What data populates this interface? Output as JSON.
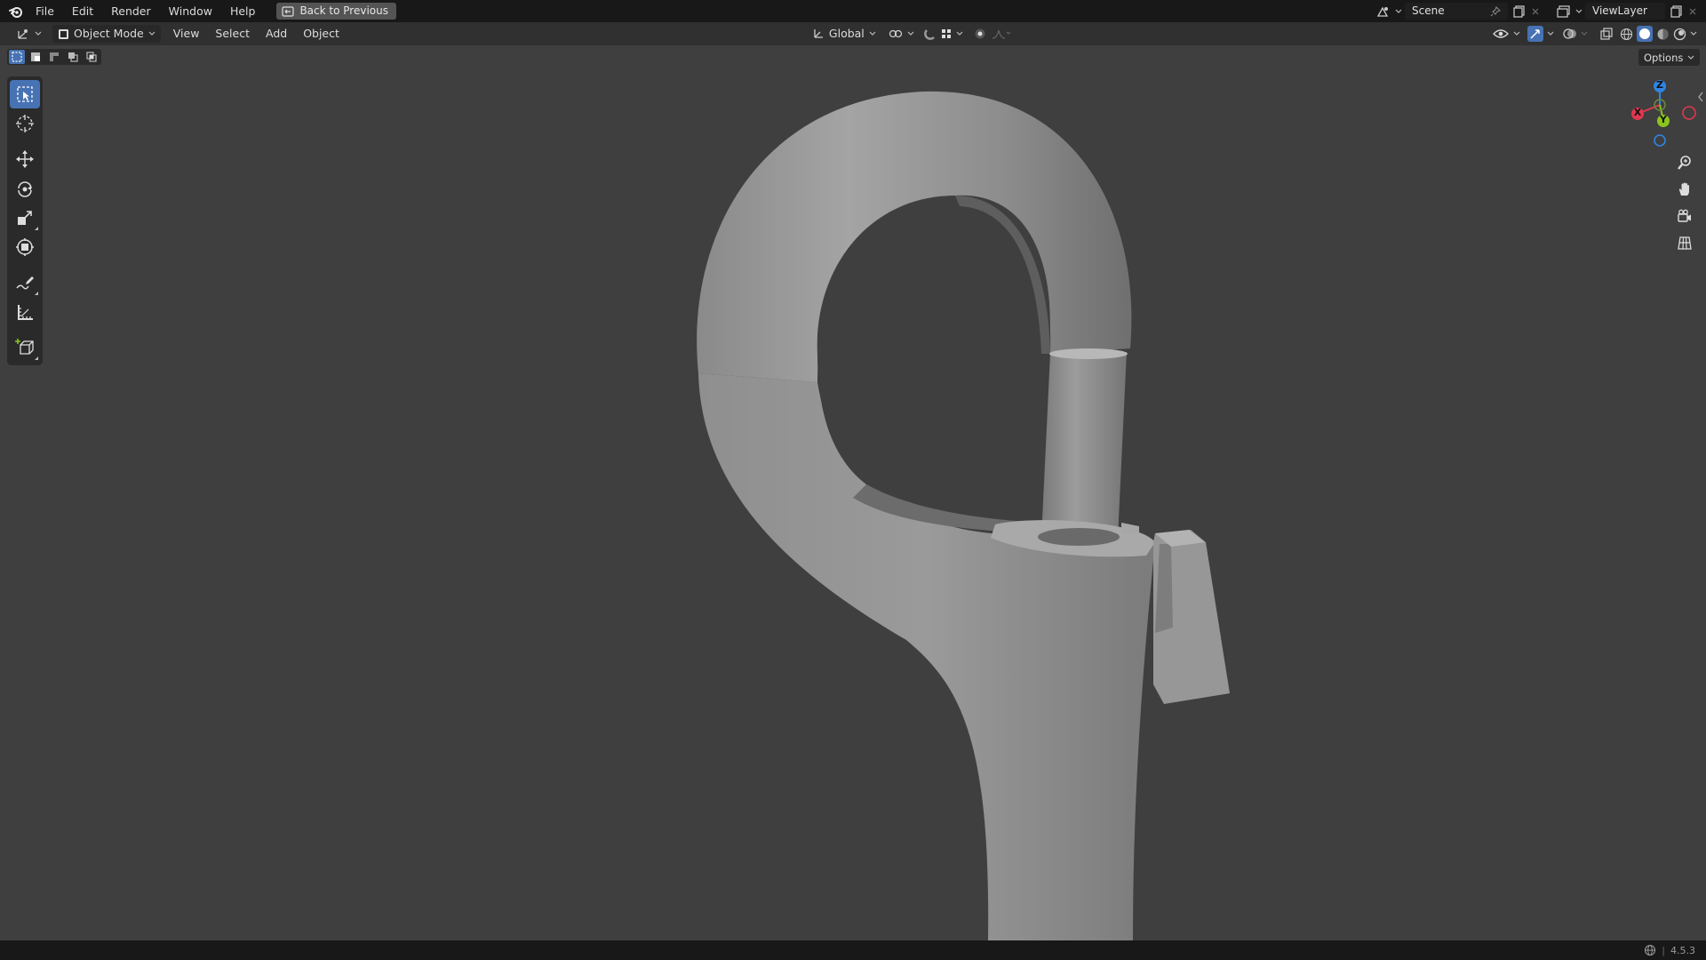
{
  "app": {
    "name": "Blender",
    "version": "4.5.3"
  },
  "menu": {
    "items": [
      "File",
      "Edit",
      "Render",
      "Window",
      "Help"
    ],
    "back_button": "Back to Previous"
  },
  "workspace": {
    "scene": "Scene",
    "view_layer": "ViewLayer"
  },
  "header": {
    "mode": "Object Mode",
    "view": "View",
    "select": "Select",
    "add": "Add",
    "object": "Object",
    "transform_orientation": "Global",
    "options": "Options"
  },
  "gizmo": {
    "x": "X",
    "y": "Y",
    "z": "Z"
  },
  "colors": {
    "accent": "#4772b3",
    "axis_x": "#e0384f",
    "axis_y": "#8bc41e",
    "axis_z": "#2f84e3",
    "viewport_bg": "#3f3f3f"
  },
  "tools": [
    "select-box-tool",
    "cursor-tool",
    "move-tool",
    "rotate-tool",
    "scale-tool",
    "transform-tool",
    "annotate-tool",
    "measure-tool",
    "add-cube-tool"
  ]
}
